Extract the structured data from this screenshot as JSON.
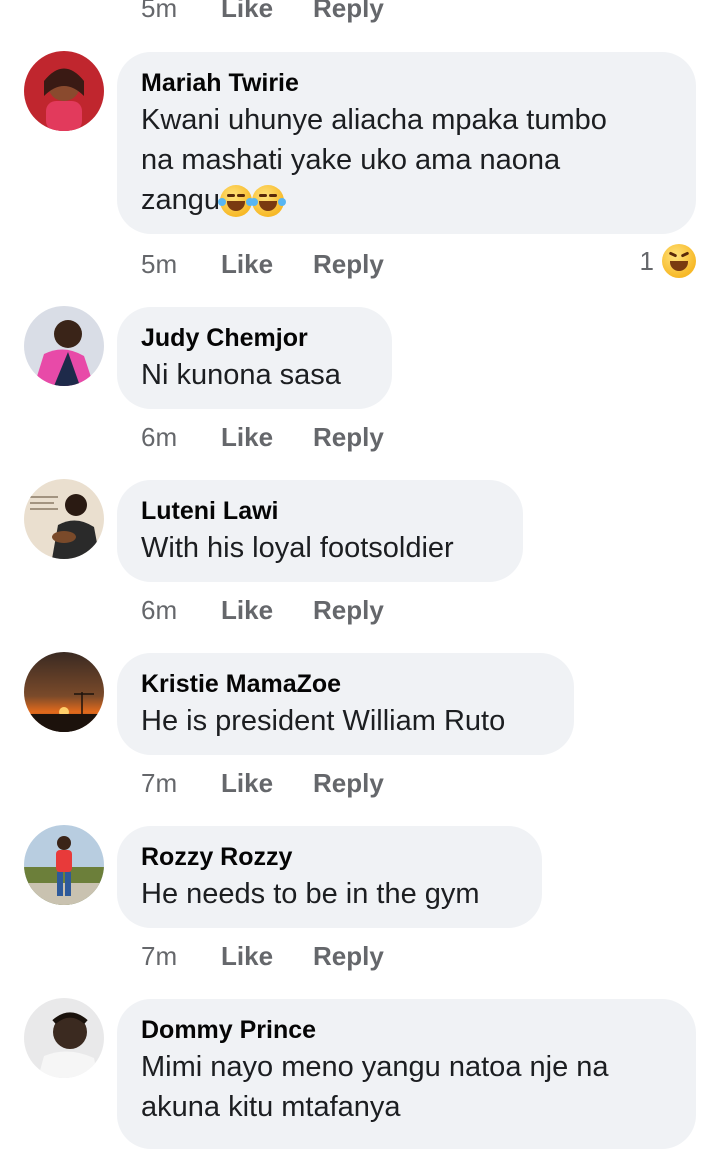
{
  "top": {
    "time": "5m",
    "like": "Like",
    "reply": "Reply"
  },
  "comments": [
    {
      "name": "Mariah Twirie",
      "lines": [
        "Kwani uhunye aliacha mpaka tumbo",
        "na mashati yake uko ama naona",
        "zangu"
      ],
      "time": "5m",
      "like": "Like",
      "reply": "Reply",
      "reaction_count": "1",
      "avatar_colors": [
        "#c0262e",
        "#f5c6a5"
      ]
    },
    {
      "name": "Judy Chemjor",
      "lines": [
        "Ni kunona sasa"
      ],
      "time": "6m",
      "like": "Like",
      "reply": "Reply",
      "avatar_colors": [
        "#d9dde6",
        "#e84aa8"
      ]
    },
    {
      "name": "Luteni Lawi",
      "lines": [
        "With his loyal footsoldier"
      ],
      "time": "6m",
      "like": "Like",
      "reply": "Reply",
      "avatar_colors": [
        "#eadfcf",
        "#2a2a2a"
      ]
    },
    {
      "name": "Kristie MamaZoe",
      "lines": [
        "He is president William Ruto"
      ],
      "time": "7m",
      "like": "Like",
      "reply": "Reply",
      "avatar_colors": [
        "#2b1c14",
        "#e36a1c"
      ]
    },
    {
      "name": "Rozzy Rozzy",
      "lines": [
        "He needs to be in the gym"
      ],
      "time": "7m",
      "like": "Like",
      "reply": "Reply",
      "avatar_colors": [
        "#b8cde0",
        "#6c7f3a"
      ]
    },
    {
      "name": "Dommy Prince",
      "lines": [
        "Mimi nayo meno yangu natoa nje na",
        "akuna kitu mtafanya"
      ],
      "avatar_colors": [
        "#e9e9ea",
        "#3b2a20"
      ]
    }
  ]
}
